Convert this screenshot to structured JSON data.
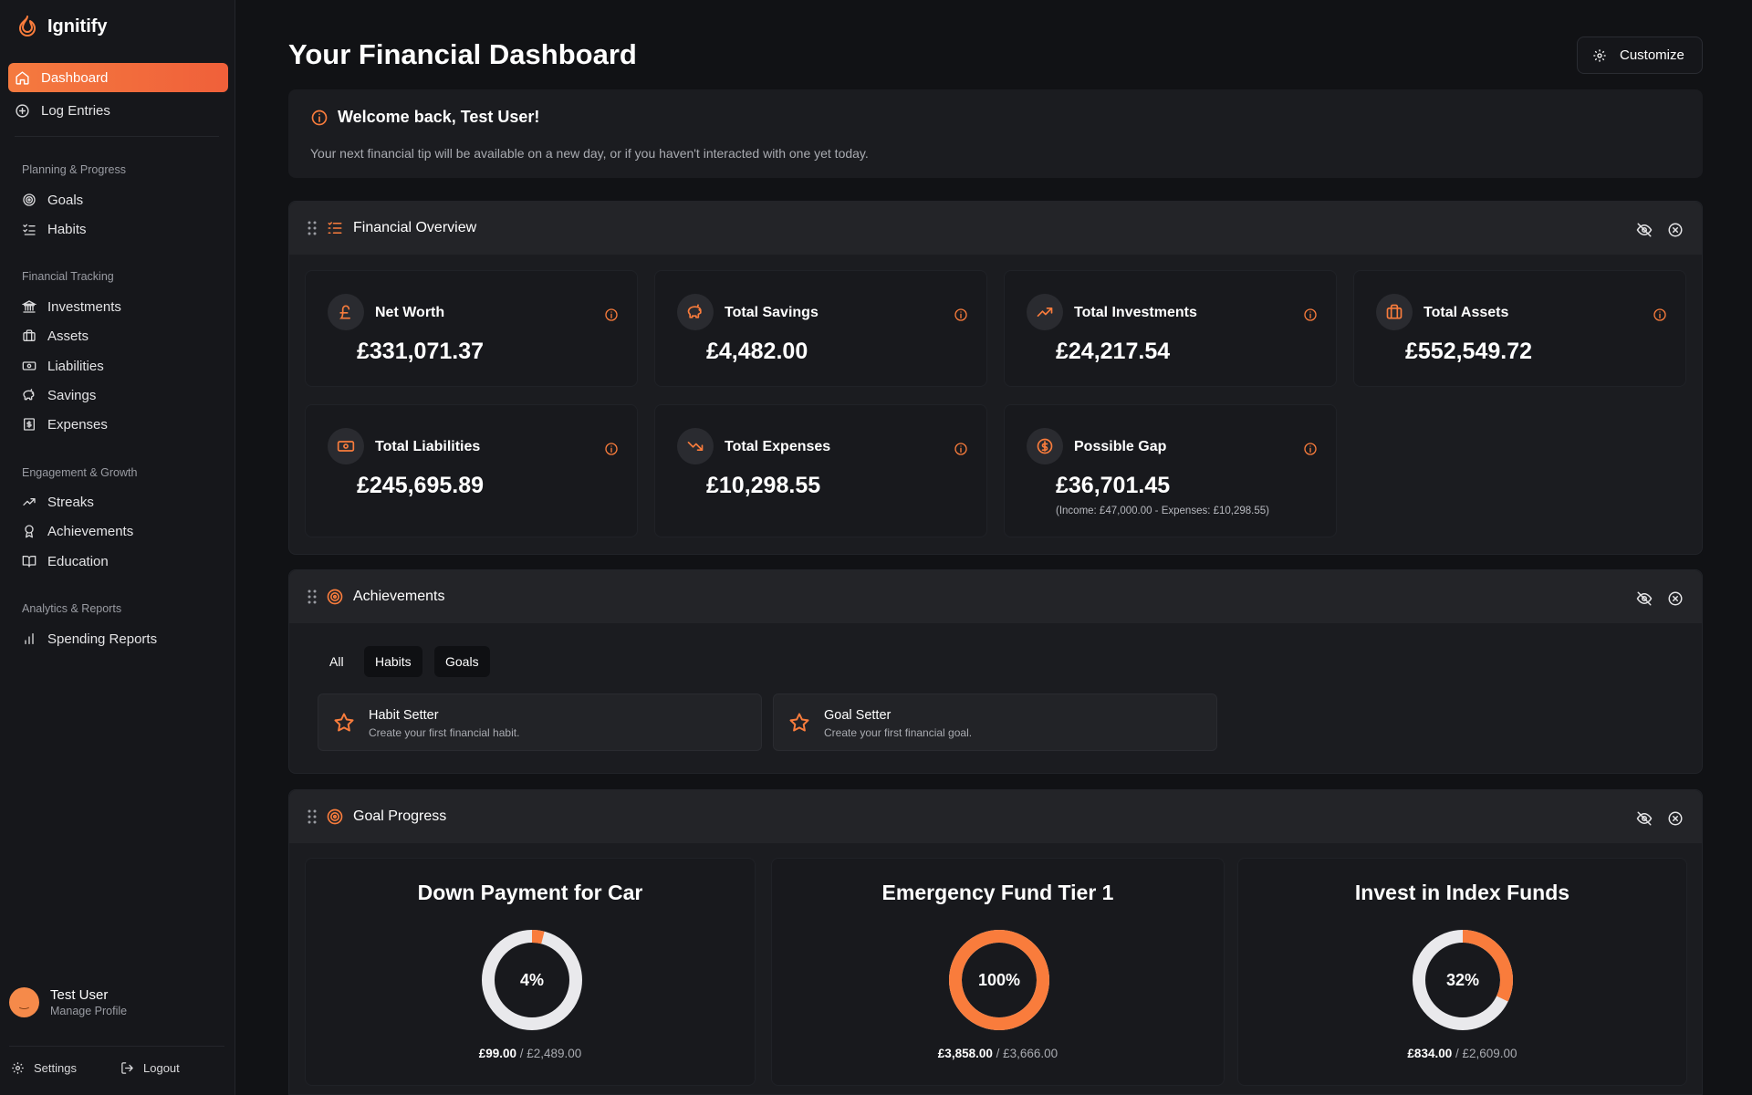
{
  "app": {
    "name": "Ignitify"
  },
  "sidebar": {
    "primary": [
      {
        "label": "Dashboard",
        "icon": "home-icon",
        "active": true
      },
      {
        "label": "Log Entries",
        "icon": "plus-circle-icon"
      }
    ],
    "sections": [
      {
        "title": "Planning & Progress",
        "items": [
          {
            "label": "Goals",
            "icon": "target-icon"
          },
          {
            "label": "Habits",
            "icon": "list-check-icon"
          }
        ]
      },
      {
        "title": "Financial Tracking",
        "items": [
          {
            "label": "Investments",
            "icon": "bank-icon"
          },
          {
            "label": "Assets",
            "icon": "briefcase-icon"
          },
          {
            "label": "Liabilities",
            "icon": "banknote-icon"
          },
          {
            "label": "Savings",
            "icon": "piggy-bank-icon"
          },
          {
            "label": "Expenses",
            "icon": "receipt-icon"
          }
        ]
      },
      {
        "title": "Engagement & Growth",
        "items": [
          {
            "label": "Streaks",
            "icon": "trending-up-icon"
          },
          {
            "label": "Achievements",
            "icon": "award-icon"
          },
          {
            "label": "Education",
            "icon": "book-icon"
          }
        ]
      },
      {
        "title": "Analytics & Reports",
        "items": [
          {
            "label": "Spending Reports",
            "icon": "bar-chart-icon"
          }
        ]
      }
    ],
    "profile": {
      "name": "Test User",
      "subtitle": "Manage Profile"
    },
    "settings_label": "Settings",
    "logout_label": "Logout"
  },
  "header": {
    "title": "Your Financial Dashboard",
    "customize_label": "Customize"
  },
  "welcome": {
    "title": "Welcome back, Test User!",
    "text": "Your next financial tip will be available on a new day, or if you haven't interacted with one yet today."
  },
  "overview": {
    "title": "Financial Overview",
    "stats": [
      {
        "label": "Net Worth",
        "value": "£331,071.37",
        "icon": "pound-icon"
      },
      {
        "label": "Total Savings",
        "value": "£4,482.00",
        "icon": "piggy-bank-icon"
      },
      {
        "label": "Total Investments",
        "value": "£24,217.54",
        "icon": "trending-up-icon"
      },
      {
        "label": "Total Assets",
        "value": "£552,549.72",
        "icon": "briefcase-icon"
      },
      {
        "label": "Total Liabilities",
        "value": "£245,695.89",
        "icon": "banknote-icon"
      },
      {
        "label": "Total Expenses",
        "value": "£10,298.55",
        "icon": "trending-down-icon"
      },
      {
        "label": "Possible Gap",
        "value": "£36,701.45",
        "icon": "dollar-circle-icon",
        "note": "(Income: £47,000.00 - Expenses: £10,298.55)"
      }
    ]
  },
  "achievements": {
    "title": "Achievements",
    "tabs": [
      "All",
      "Habits",
      "Goals"
    ],
    "items": [
      {
        "title": "Habit Setter",
        "desc": "Create your first financial habit."
      },
      {
        "title": "Goal Setter",
        "desc": "Create your first financial goal."
      }
    ]
  },
  "goals": {
    "title": "Goal Progress",
    "items": [
      {
        "title": "Down Payment for Car",
        "percent": 4,
        "percent_label": "4%",
        "current": "£99.00",
        "target": "/ £2,489.00"
      },
      {
        "title": "Emergency Fund Tier 1",
        "percent": 100,
        "percent_label": "100%",
        "current": "£3,858.00",
        "target": "/ £3,666.00"
      },
      {
        "title": "Invest in Index Funds",
        "percent": 32,
        "percent_label": "32%",
        "current": "£834.00",
        "target": "/ £2,609.00"
      }
    ]
  },
  "colors": {
    "accent": "#f97c3c",
    "background": "#111215",
    "panel": "#1b1c20",
    "ring_track": "#e9e9ec"
  }
}
